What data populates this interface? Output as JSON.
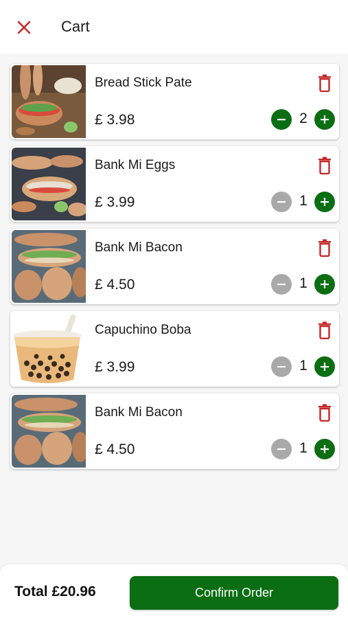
{
  "header": {
    "title": "Cart",
    "close_icon": "close-icon"
  },
  "colors": {
    "accent_green": "#0b6e12",
    "danger_red": "#c62828",
    "disabled_gray": "#a9a9a9"
  },
  "items": [
    {
      "name": "Bread Stick Pate",
      "price": "£ 3.98",
      "quantity": "2",
      "image": "bread-stick-pate-photo"
    },
    {
      "name": "Bank Mi Eggs",
      "price": "£ 3.99",
      "quantity": "1",
      "image": "bank-mi-eggs-photo"
    },
    {
      "name": "Bank Mi Bacon",
      "price": "£ 4.50",
      "quantity": "1",
      "image": "bank-mi-bacon-photo"
    },
    {
      "name": "Capuchino Boba",
      "price": "£ 3.99",
      "quantity": "1",
      "image": "capuchino-boba-photo"
    },
    {
      "name": "Bank Mi Bacon",
      "price": "£ 4.50",
      "quantity": "1",
      "image": "bank-mi-bacon-photo"
    }
  ],
  "footer": {
    "total": "Total £20.96",
    "confirm_label": "Confirm Order"
  }
}
